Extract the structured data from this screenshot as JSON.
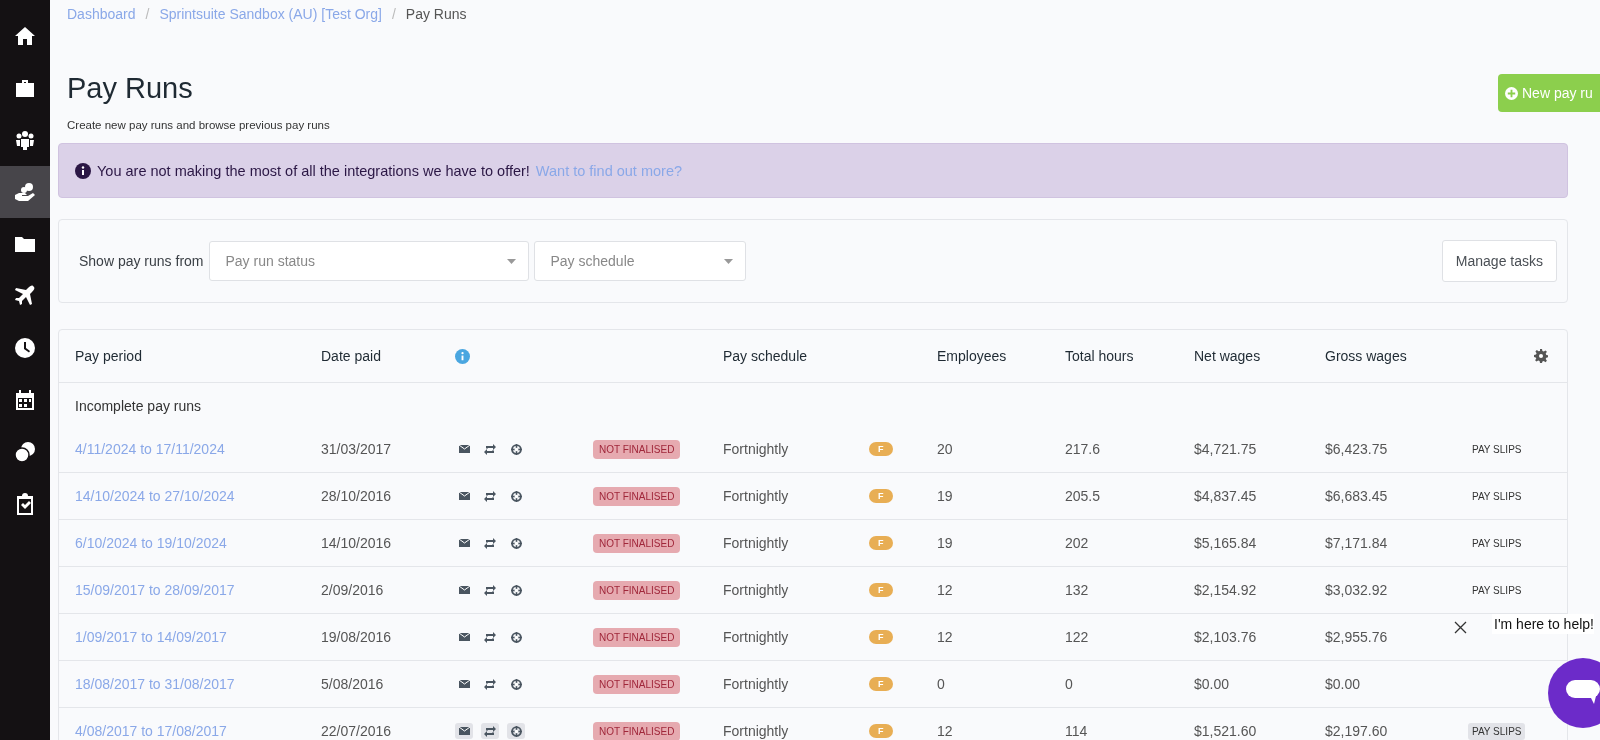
{
  "sidebar": {
    "items": [
      {
        "kind": "home",
        "selected": false
      },
      {
        "kind": "briefcase",
        "selected": false
      },
      {
        "kind": "people",
        "selected": false
      },
      {
        "kind": "hand-coin",
        "selected": true
      },
      {
        "kind": "folder",
        "selected": false
      },
      {
        "kind": "plane",
        "selected": false
      },
      {
        "kind": "clock",
        "selected": false
      },
      {
        "kind": "calendar",
        "selected": false
      },
      {
        "kind": "coins",
        "selected": false
      },
      {
        "kind": "clipboard",
        "selected": false
      }
    ]
  },
  "breadcrumb": [
    {
      "label": "Dashboard",
      "separator": "/"
    },
    {
      "label": "Sprintsuite Sandbox (AU) [Test Org]",
      "separator": "/"
    },
    {
      "label": "Pay Runs"
    }
  ],
  "page": {
    "title": "Pay Runs",
    "subtitle": "Create new pay runs and browse previous pay runs",
    "new_button": "New pay ru"
  },
  "alert": {
    "message": "You are not making the most of all the integrations we have to offer!",
    "link": "Want to find out more?"
  },
  "filters": {
    "label": "Show pay runs from",
    "selects": [
      {
        "placeholder": "Pay run status"
      },
      {
        "placeholder": "Pay schedule"
      }
    ],
    "button": "Manage tasks"
  },
  "table": {
    "columns": [
      "Pay period",
      "Date paid",
      "Pay schedule",
      "Employees",
      "Total hours",
      "Net wages",
      "Gross wages"
    ],
    "group": "Incomplete pay runs",
    "rows": [
      {
        "period": "4/11/2024 to 17/11/2024",
        "date_paid": "31/03/2017",
        "status": "NOT FINALISED",
        "schedule": "Fortnightly",
        "schedule_badge": "F",
        "employees": "20",
        "hours": "217.6",
        "net": "$4,721.75",
        "gross": "$6,423.75",
        "action": "PAY SLIPS",
        "highlighted": false
      },
      {
        "period": "14/10/2024 to 27/10/2024",
        "date_paid": "28/10/2016",
        "status": "NOT FINALISED",
        "schedule": "Fortnightly",
        "schedule_badge": "F",
        "employees": "19",
        "hours": "205.5",
        "net": "$4,837.45",
        "gross": "$6,683.45",
        "action": "PAY SLIPS",
        "highlighted": false
      },
      {
        "period": "6/10/2024 to 19/10/2024",
        "date_paid": "14/10/2016",
        "status": "NOT FINALISED",
        "schedule": "Fortnightly",
        "schedule_badge": "F",
        "employees": "19",
        "hours": "202",
        "net": "$5,165.84",
        "gross": "$7,171.84",
        "action": "PAY SLIPS",
        "highlighted": false
      },
      {
        "period": "15/09/2017 to 28/09/2017",
        "date_paid": "2/09/2016",
        "status": "NOT FINALISED",
        "schedule": "Fortnightly",
        "schedule_badge": "F",
        "employees": "12",
        "hours": "132",
        "net": "$2,154.92",
        "gross": "$3,032.92",
        "action": "PAY SLIPS",
        "highlighted": false
      },
      {
        "period": "1/09/2017 to 14/09/2017",
        "date_paid": "19/08/2016",
        "status": "NOT FINALISED",
        "schedule": "Fortnightly",
        "schedule_badge": "F",
        "employees": "12",
        "hours": "122",
        "net": "$2,103.76",
        "gross": "$2,955.76",
        "highlighted": false
      },
      {
        "period": "18/08/2017 to 31/08/2017",
        "date_paid": "5/08/2016",
        "status": "NOT FINALISED",
        "schedule": "Fortnightly",
        "schedule_badge": "F",
        "employees": "0",
        "hours": "0",
        "net": "$0.00",
        "gross": "$0.00",
        "highlighted": false
      },
      {
        "period": "4/08/2017 to 17/08/2017",
        "date_paid": "22/07/2016",
        "status": "NOT FINALISED",
        "schedule": "Fortnightly",
        "schedule_badge": "F",
        "employees": "12",
        "hours": "114",
        "net": "$1,521.60",
        "gross": "$2,197.60",
        "action": "PAY SLIPS",
        "highlighted": true
      }
    ]
  },
  "chat": {
    "message": "I'm here to help!"
  }
}
